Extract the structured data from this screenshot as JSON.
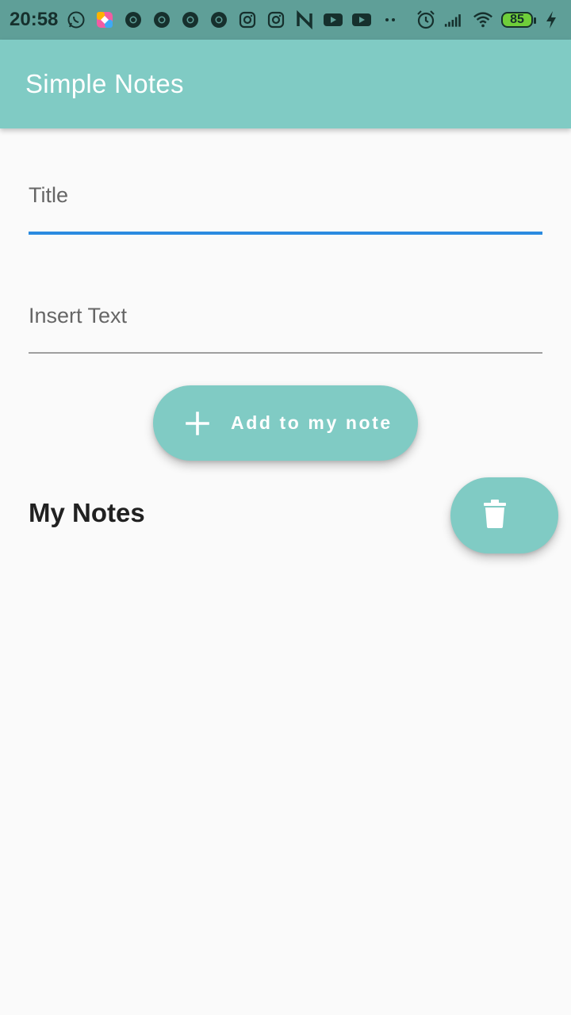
{
  "status_bar": {
    "time": "20:58",
    "battery_level": "85",
    "left_icons": [
      "whatsapp-icon",
      "colorful-app-icon",
      "chrome-icon",
      "chrome-icon",
      "chrome-icon",
      "chrome-icon",
      "instagram-icon",
      "instagram-icon",
      "n-app-icon",
      "youtube-icon",
      "youtube-icon",
      "more-dots-icon"
    ],
    "right_icons": [
      "alarm-icon",
      "signal-icon",
      "wifi-icon",
      "battery-icon",
      "charging-icon"
    ]
  },
  "app_bar": {
    "title": "Simple Notes"
  },
  "form": {
    "title_placeholder": "Title",
    "title_value": "",
    "text_placeholder": "Insert Text",
    "text_value": "",
    "add_button_label": "Add to my note"
  },
  "notes": {
    "section_title": "My Notes",
    "items": []
  },
  "colors": {
    "accent": "#80cbc4",
    "status_bar": "#5f9f98",
    "focus_underline": "#2b8be0",
    "background": "#fafafa"
  }
}
